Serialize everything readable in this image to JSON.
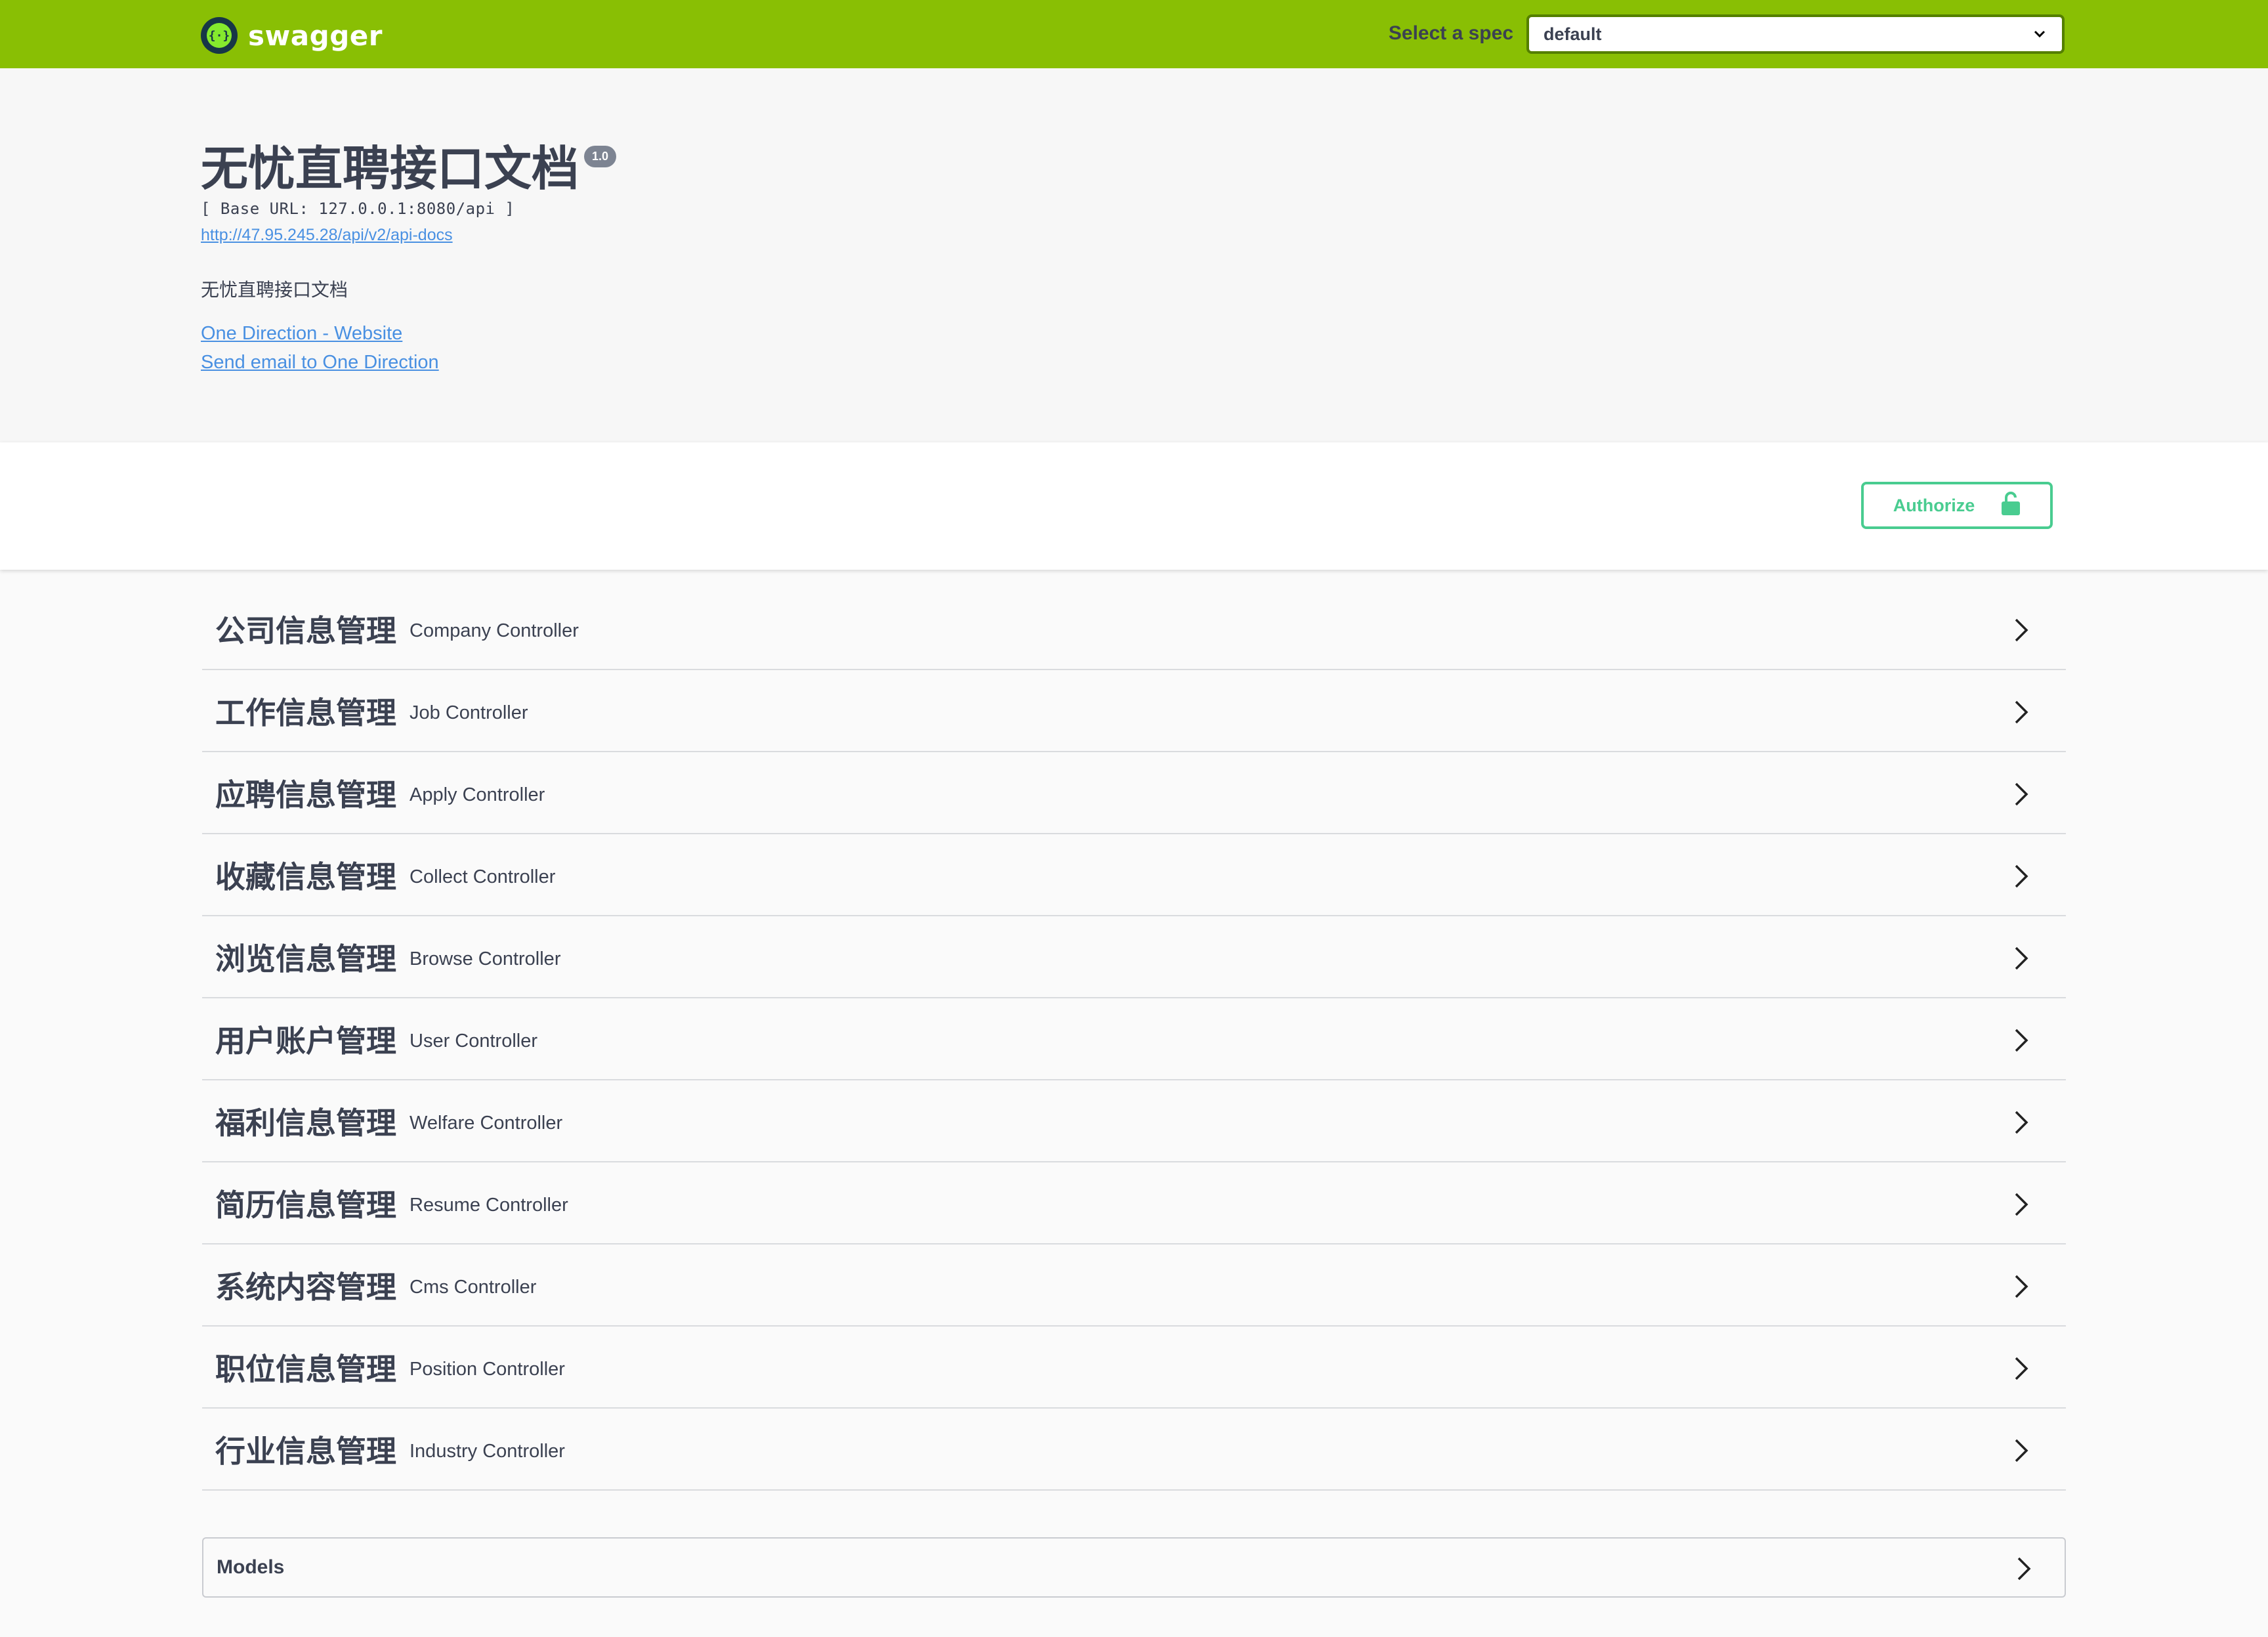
{
  "topbar": {
    "logo_text": "swagger",
    "logo_icon": "swagger-braces-icon",
    "spec_label": "Select a spec",
    "spec_selected": "default",
    "background": "#89bf04"
  },
  "info": {
    "title": "无忧直聘接口文档",
    "version": "1.0",
    "base_url": "[ Base URL: 127.0.0.1:8080/api ]",
    "spec_url": "http://47.95.245.28/api/v2/api-docs",
    "description": "无忧直聘接口文档",
    "contact_website": "One Direction - Website",
    "contact_email": "Send email to One Direction"
  },
  "auth": {
    "button_label": "Authorize",
    "icon": "unlocked-lock-icon",
    "color": "#49cc90"
  },
  "tags": [
    {
      "cn": "公司信息管理",
      "en": "Company Controller"
    },
    {
      "cn": "工作信息管理",
      "en": "Job Controller"
    },
    {
      "cn": "应聘信息管理",
      "en": "Apply Controller"
    },
    {
      "cn": "收藏信息管理",
      "en": "Collect Controller"
    },
    {
      "cn": "浏览信息管理",
      "en": "Browse Controller"
    },
    {
      "cn": "用户账户管理",
      "en": "User Controller"
    },
    {
      "cn": "福利信息管理",
      "en": "Welfare Controller"
    },
    {
      "cn": "简历信息管理",
      "en": "Resume Controller"
    },
    {
      "cn": "系统内容管理",
      "en": "Cms Controller"
    },
    {
      "cn": "职位信息管理",
      "en": "Position Controller"
    },
    {
      "cn": "行业信息管理",
      "en": "Industry Controller"
    }
  ],
  "models": {
    "title": "Models"
  }
}
